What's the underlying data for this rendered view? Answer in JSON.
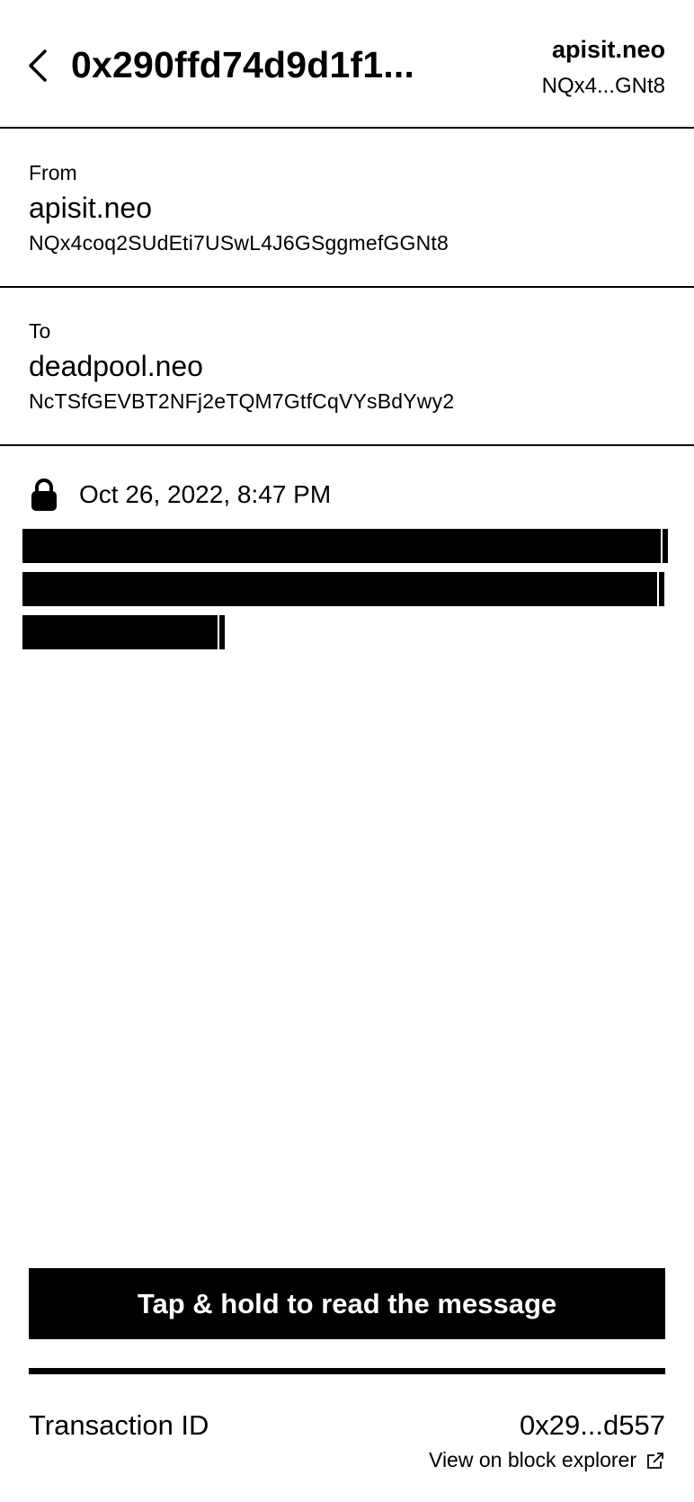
{
  "header": {
    "back_icon": "chevron-left-icon",
    "title": "0x290ffd74d9d1f1...",
    "account_name": "apisit.neo",
    "account_address": "NQx4...GNt8"
  },
  "from": {
    "label": "From",
    "name": "apisit.neo",
    "address": "NQx4coq2SUdEti7USwL4J6GSggmefGGNt8"
  },
  "to": {
    "label": "To",
    "name": "deadpool.neo",
    "address": "NcTSfGEVBT2NFj2eTQM7GtfCqVYsBdYwy2"
  },
  "message": {
    "lock_icon": "lock-icon",
    "date": "Oct 26, 2022, 8:47 PM"
  },
  "actions": {
    "read_button": "Tap & hold to read the message"
  },
  "transaction": {
    "label": "Transaction ID",
    "id_short": "0x29...d557",
    "explorer_link": "View on block explorer",
    "external_icon": "external-link-icon"
  }
}
